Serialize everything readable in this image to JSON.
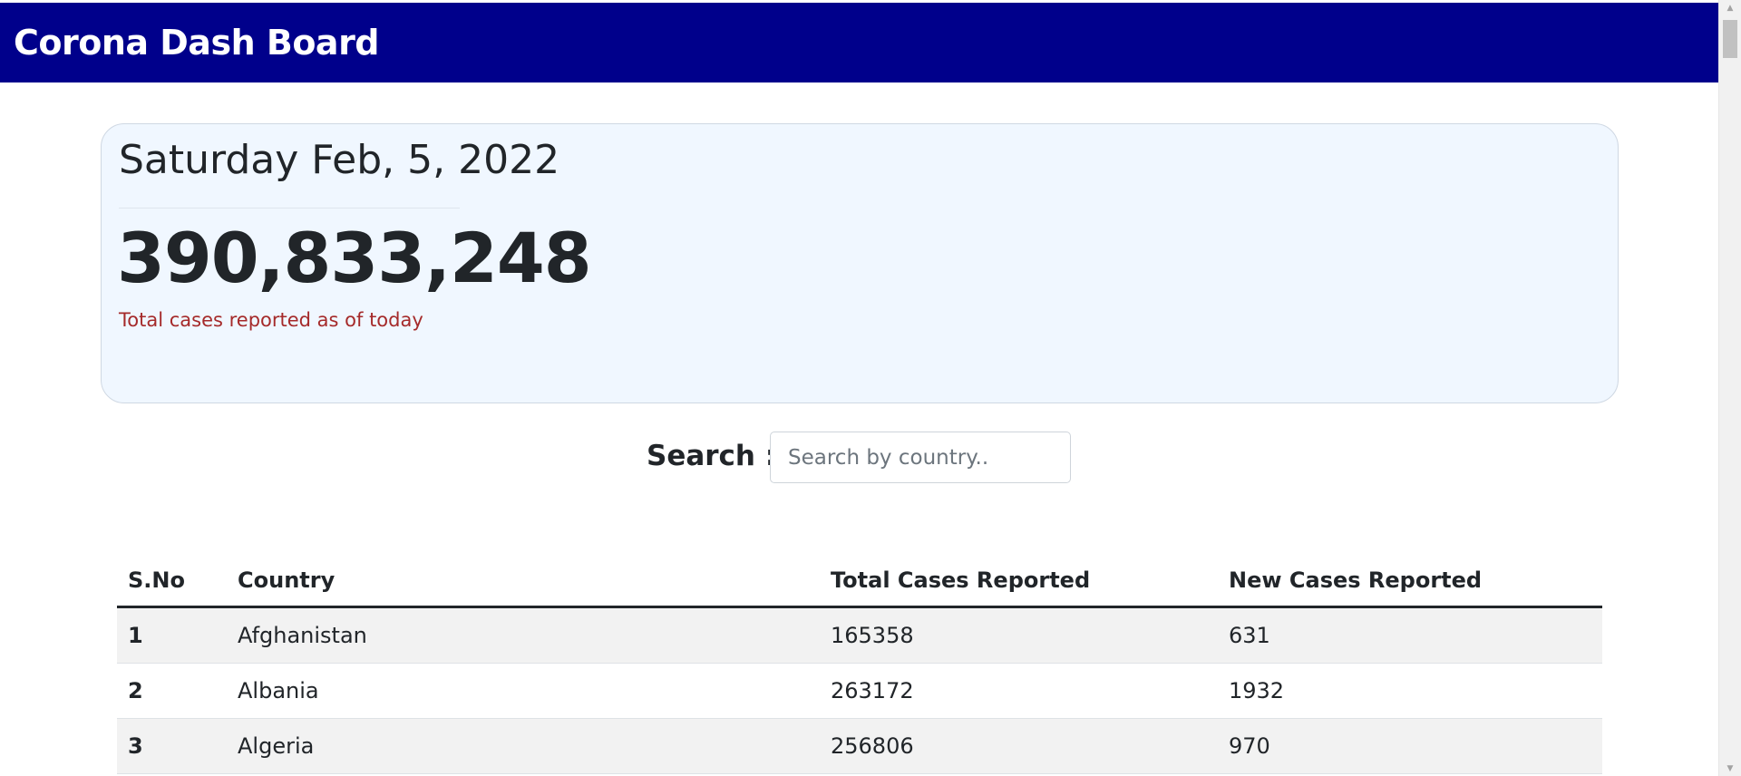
{
  "navbar": {
    "brand": "Corona Dash Board"
  },
  "summary": {
    "date": "Saturday Feb, 5, 2022",
    "total_cases": "390,833,248",
    "caption": "Total cases reported as of today"
  },
  "search": {
    "label": "Search :",
    "placeholder": "Search by country.."
  },
  "table": {
    "headers": {
      "sno": "S.No",
      "country": "Country",
      "total": "Total Cases Reported",
      "new": "New Cases Reported"
    },
    "rows": [
      {
        "sno": "1",
        "country": "Afghanistan",
        "total": "165358",
        "new": "631"
      },
      {
        "sno": "2",
        "country": "Albania",
        "total": "263172",
        "new": "1932"
      },
      {
        "sno": "3",
        "country": "Algeria",
        "total": "256806",
        "new": "970"
      }
    ]
  },
  "icons": {
    "scroll_up": "triangle-up-icon",
    "scroll_down": "triangle-down-icon"
  },
  "colors": {
    "navbar_bg": "#00008b",
    "jumbotron_bg": "#f0f7ff",
    "caption": "#a52a2a"
  }
}
